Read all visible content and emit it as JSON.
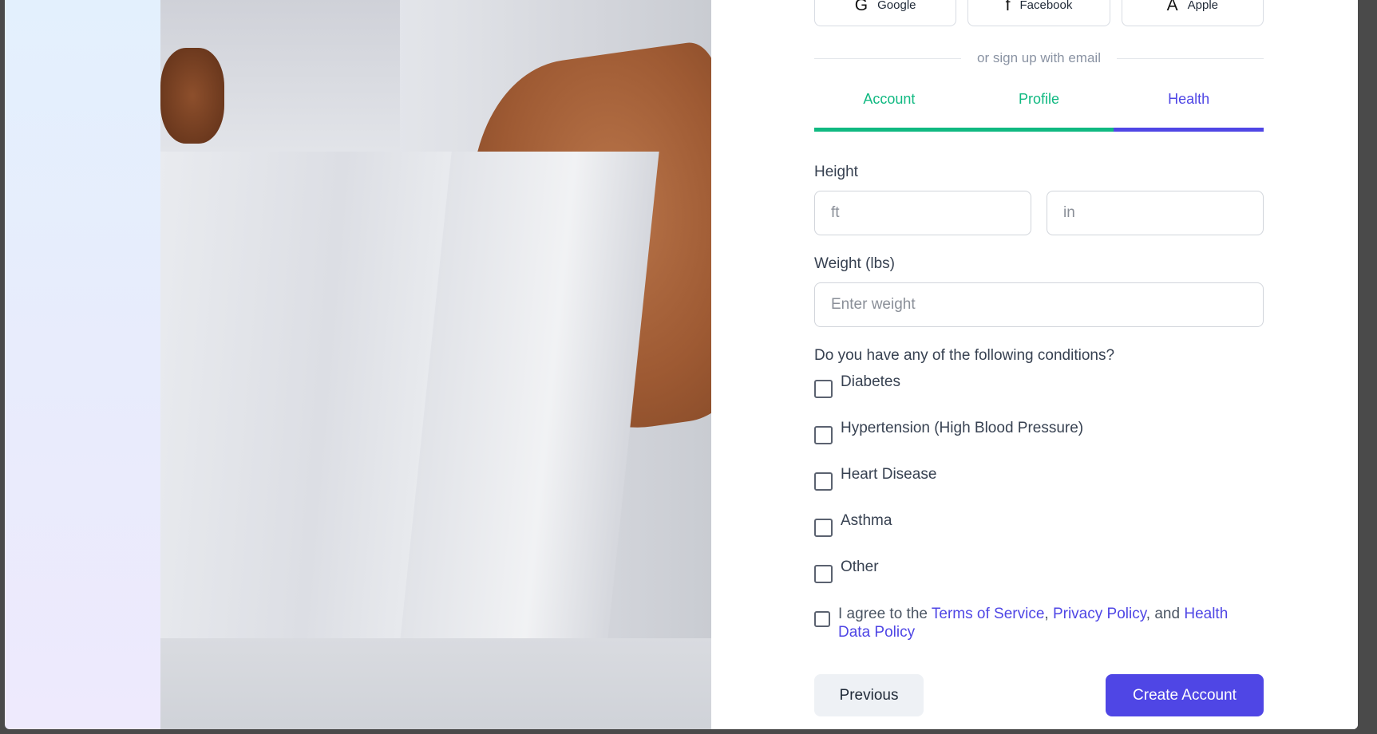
{
  "social": {
    "google": {
      "icon": "google-icon",
      "glyph": "G",
      "label": "Google"
    },
    "facebook": {
      "icon": "facebook-icon",
      "glyph": "f",
      "label": "Facebook"
    },
    "apple": {
      "icon": "apple-icon",
      "glyph": "A",
      "label": "Apple"
    }
  },
  "divider_text": "or sign up with email",
  "tabs": [
    {
      "label": "Account",
      "state": "complete"
    },
    {
      "label": "Profile",
      "state": "complete"
    },
    {
      "label": "Health",
      "state": "active"
    }
  ],
  "height": {
    "label": "Height",
    "ft_placeholder": "ft",
    "in_placeholder": "in"
  },
  "weight": {
    "label": "Weight (lbs)",
    "placeholder": "Enter weight"
  },
  "conditions": {
    "title": "Do you have any of the following conditions?",
    "items": [
      {
        "label": "Diabetes",
        "checked": false
      },
      {
        "label": "Hypertension (High Blood Pressure)",
        "checked": false
      },
      {
        "label": "Heart Disease",
        "checked": false
      },
      {
        "label": "Asthma",
        "checked": false
      },
      {
        "label": "Other",
        "checked": false
      }
    ]
  },
  "agree": {
    "prefix": "I agree to the ",
    "terms": "Terms of Service",
    "comma": ", ",
    "privacy": "Privacy Policy",
    "and": ", and ",
    "health": "Health Data Policy",
    "checked": false
  },
  "buttons": {
    "previous": "Previous",
    "create": "Create Account"
  },
  "colors": {
    "accent": "#4f46e5",
    "success": "#10b981"
  }
}
